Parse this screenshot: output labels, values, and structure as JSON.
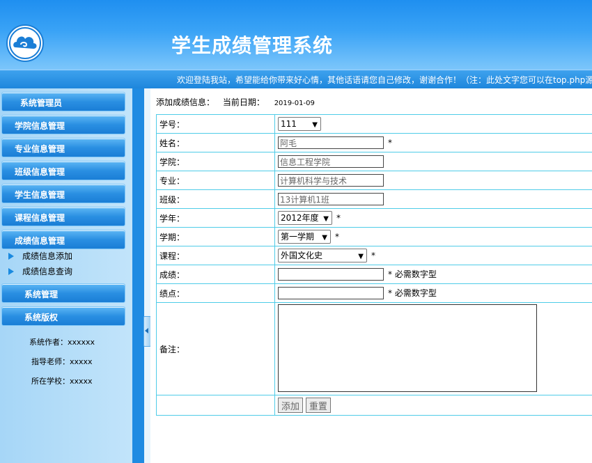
{
  "header": {
    "title": "学生成绩管理系统",
    "logo_icon": "cloud-logo-icon",
    "marquee": "欢迎登陆我站，希望能给你带来好心情，其他话语请您自己修改，谢谢合作！（注：此处文字您可以在top.php源"
  },
  "sidebar": {
    "menu": [
      {
        "label": "系统管理员"
      },
      {
        "label": "学院信息管理"
      },
      {
        "label": "专业信息管理"
      },
      {
        "label": "班级信息管理"
      },
      {
        "label": "学生信息管理"
      },
      {
        "label": "课程信息管理"
      },
      {
        "label": "成绩信息管理"
      }
    ],
    "sub_items": [
      {
        "label": "成绩信息添加"
      },
      {
        "label": "成绩信息查询"
      }
    ],
    "menu2": [
      {
        "label": "系统管理"
      },
      {
        "label": "系统版权"
      }
    ],
    "info": {
      "author": "系统作者：xxxxxx",
      "advisor": "指导老师：xxxxx",
      "school": "所在学校：xxxxx"
    }
  },
  "form": {
    "heading": "添加成绩信息：",
    "date_label": "当前日期：",
    "date_value": "2019-01-09",
    "required_mark": "*",
    "numeric_hint": "* 必需数字型",
    "fields": {
      "student_id": {
        "label": "学号：",
        "value": "111"
      },
      "name": {
        "label": "姓名：",
        "value": "阿毛"
      },
      "college": {
        "label": "学院：",
        "value": "信息工程学院"
      },
      "major": {
        "label": "专业：",
        "value": "计算机科学与技术"
      },
      "class": {
        "label": "班级：",
        "value": "13计算机1班"
      },
      "year": {
        "label": "学年：",
        "value": "2012年度"
      },
      "term": {
        "label": "学期：",
        "value": "第一学期"
      },
      "course": {
        "label": "课程：",
        "value": "外国文化史"
      },
      "score": {
        "label": "成绩：",
        "value": ""
      },
      "gpa": {
        "label": "绩点：",
        "value": ""
      },
      "remark": {
        "label": "备注：",
        "value": ""
      }
    },
    "buttons": {
      "add": "添加",
      "reset": "重置"
    }
  }
}
